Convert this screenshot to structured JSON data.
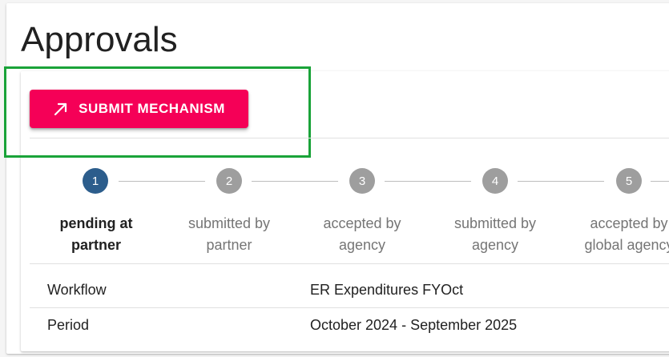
{
  "page": {
    "title": "Approvals"
  },
  "actions": {
    "submit_label": "SUBMIT MECHANISM",
    "submit_icon": "arrow-up-right-icon"
  },
  "steps": [
    {
      "number": "1",
      "label_line1": "pending at",
      "label_line2": "partner",
      "active": true
    },
    {
      "number": "2",
      "label_line1": "submitted by",
      "label_line2": "partner",
      "active": false
    },
    {
      "number": "3",
      "label_line1": "accepted by",
      "label_line2": "agency",
      "active": false
    },
    {
      "number": "4",
      "label_line1": "submitted by",
      "label_line2": "agency",
      "active": false
    },
    {
      "number": "5",
      "label_line1": "accepted by",
      "label_line2": "global agency",
      "active": false
    }
  ],
  "details": [
    {
      "key": "Workflow",
      "value": "ER Expenditures FYOct"
    },
    {
      "key": "Period",
      "value": "October 2024 - September 2025"
    }
  ],
  "colors": {
    "accent": "#f50057",
    "active_step": "#2c5d8c",
    "inactive_step": "#9e9e9e",
    "highlight": "#1aa339"
  }
}
